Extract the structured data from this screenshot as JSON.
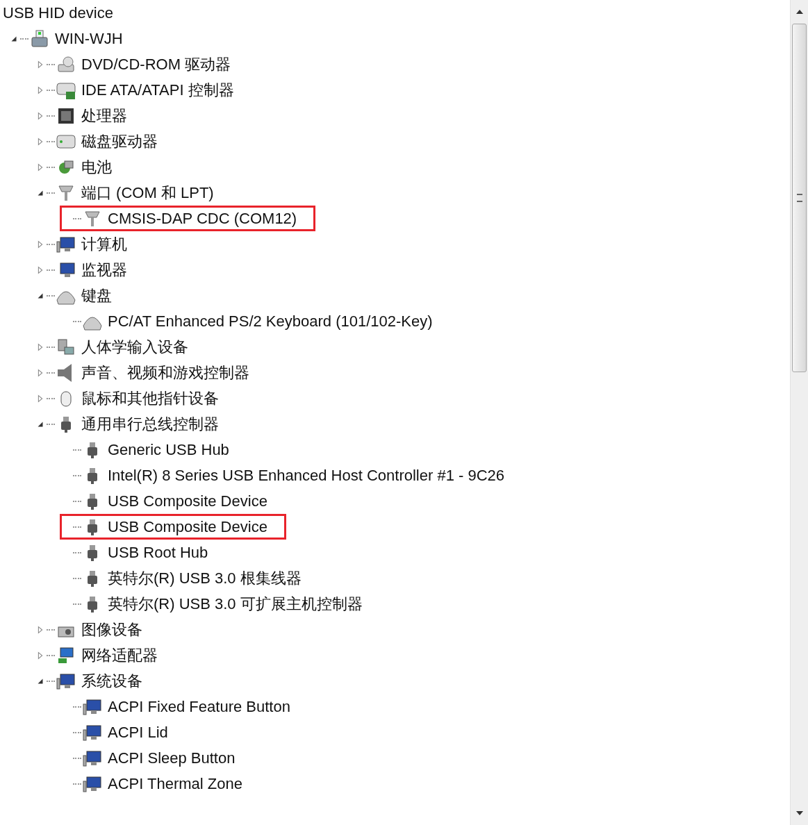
{
  "cut_top": "USB HID device",
  "root": {
    "label": "WIN-WJH",
    "kind": "computer",
    "expanded": true,
    "children": [
      {
        "label": "DVD/CD-ROM 驱动器",
        "kind": "disc",
        "expanded": false
      },
      {
        "label": "IDE ATA/ATAPI 控制器",
        "kind": "ide",
        "expanded": false
      },
      {
        "label": "处理器",
        "kind": "cpu",
        "expanded": false
      },
      {
        "label": "磁盘驱动器",
        "kind": "disk",
        "expanded": false
      },
      {
        "label": "电池",
        "kind": "battery",
        "expanded": false
      },
      {
        "label": "端口 (COM 和 LPT)",
        "kind": "port",
        "expanded": true,
        "children": [
          {
            "label": "CMSIS-DAP CDC (COM12)",
            "kind": "port",
            "highlighted": true
          }
        ]
      },
      {
        "label": "计算机",
        "kind": "system",
        "expanded": false
      },
      {
        "label": "监视器",
        "kind": "monitor",
        "expanded": false
      },
      {
        "label": "键盘",
        "kind": "keyboard",
        "expanded": true,
        "children": [
          {
            "label": "PC/AT Enhanced PS/2 Keyboard (101/102-Key)",
            "kind": "keyboard",
            "highlighted": false
          }
        ]
      },
      {
        "label": "人体学输入设备",
        "kind": "hid",
        "expanded": false
      },
      {
        "label": "声音、视频和游戏控制器",
        "kind": "sound",
        "expanded": false
      },
      {
        "label": "鼠标和其他指针设备",
        "kind": "mouse",
        "expanded": false
      },
      {
        "label": "通用串行总线控制器",
        "kind": "usb",
        "expanded": true,
        "children": [
          {
            "label": "Generic USB Hub",
            "kind": "usb",
            "highlighted": false
          },
          {
            "label": "Intel(R) 8 Series USB Enhanced Host Controller #1 - 9C26",
            "kind": "usb",
            "highlighted": false
          },
          {
            "label": "USB Composite Device",
            "kind": "usb",
            "highlighted": false
          },
          {
            "label": "USB Composite Device",
            "kind": "usb",
            "highlighted": true
          },
          {
            "label": "USB Root Hub",
            "kind": "usb",
            "highlighted": false
          },
          {
            "label": "英特尔(R) USB 3.0 根集线器",
            "kind": "usb",
            "highlighted": false
          },
          {
            "label": "英特尔(R) USB 3.0 可扩展主机控制器",
            "kind": "usb",
            "highlighted": false
          }
        ]
      },
      {
        "label": "图像设备",
        "kind": "imaging",
        "expanded": false
      },
      {
        "label": "网络适配器",
        "kind": "network",
        "expanded": false
      },
      {
        "label": "系统设备",
        "kind": "system",
        "expanded": true,
        "children": [
          {
            "label": "ACPI Fixed Feature Button",
            "kind": "system",
            "highlighted": false
          },
          {
            "label": "ACPI Lid",
            "kind": "system",
            "highlighted": false
          },
          {
            "label": "ACPI Sleep Button",
            "kind": "system",
            "highlighted": false
          },
          {
            "label": "ACPI Thermal Zone",
            "kind": "system",
            "highlighted": false
          }
        ]
      }
    ]
  }
}
